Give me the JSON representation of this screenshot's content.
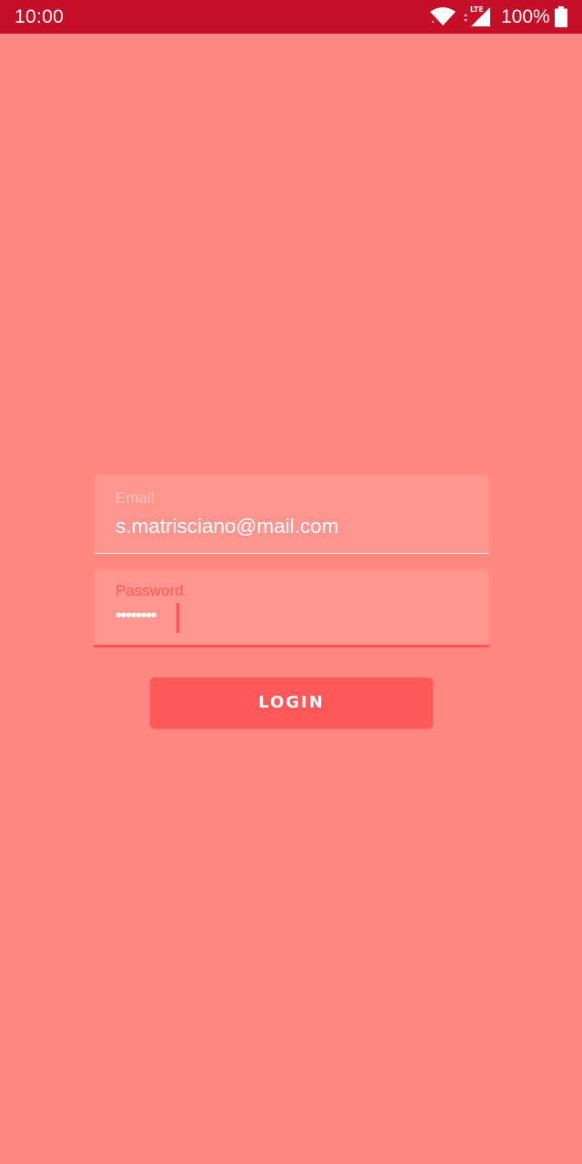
{
  "status_bar": {
    "time": "10:00",
    "battery": "100%",
    "network": "LTE",
    "icons": [
      "wifi-icon",
      "lte-signal-icon",
      "battery-icon"
    ]
  },
  "login_form": {
    "email": {
      "label": "Email",
      "value": "s.matrisciano@mail.com"
    },
    "password": {
      "label": "Password",
      "value": "••••••••"
    },
    "login_button": "LOGIN"
  },
  "colors": {
    "background": "#ff8880",
    "status_bar": "#c50f28",
    "field_background": "#ff958e",
    "accent": "#ff5252",
    "button": "#ff5858"
  }
}
